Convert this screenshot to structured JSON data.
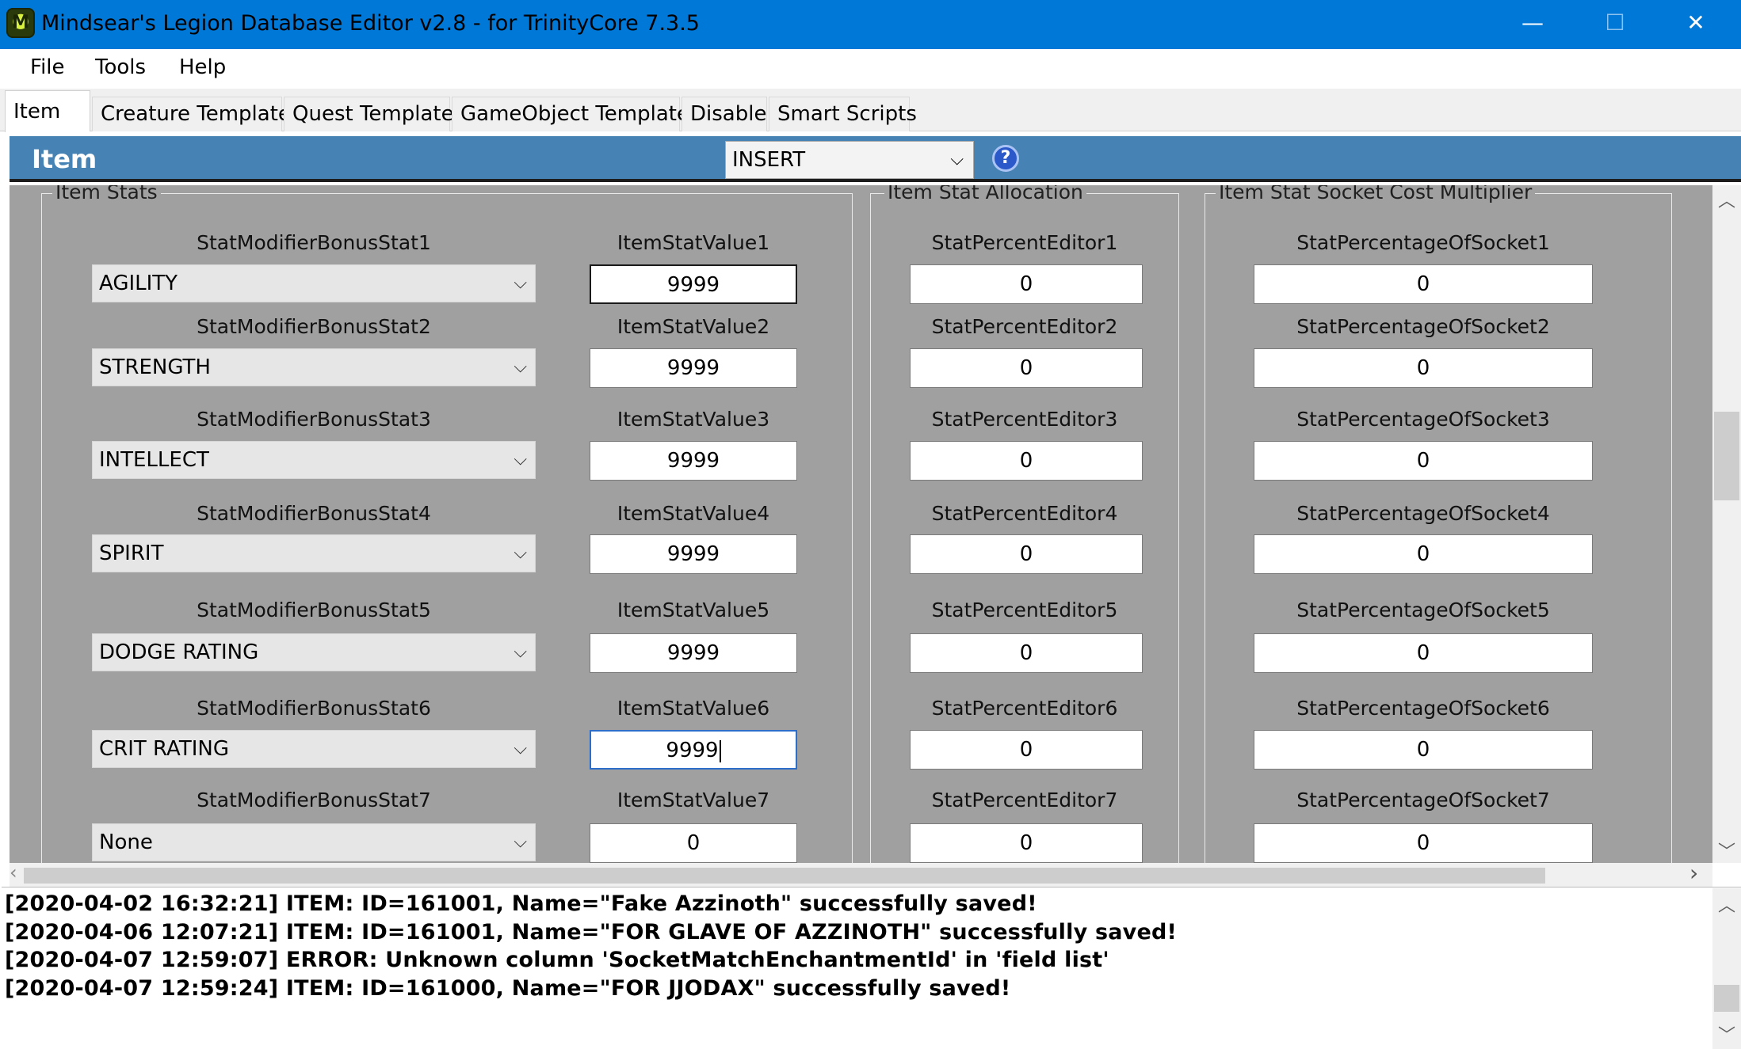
{
  "window": {
    "title": "Mindsear's Legion Database Editor v2.8 - for TrinityCore 7.3.5",
    "icon_letter": "M",
    "minimize_glyph": "—",
    "maximize_glyph": "☐",
    "close_glyph": "✕"
  },
  "menu": [
    "File",
    "Tools",
    "Help"
  ],
  "tabs": [
    {
      "label": "Item",
      "active": true
    },
    {
      "label": "Creature Template",
      "active": false
    },
    {
      "label": "Quest Template",
      "active": false
    },
    {
      "label": "GameObject Template",
      "active": false
    },
    {
      "label": "Disable",
      "active": false
    },
    {
      "label": "Smart Scripts",
      "active": false
    }
  ],
  "header": {
    "title": "Item",
    "mode": "INSERT",
    "help_glyph": "?"
  },
  "groups": {
    "item_stats": "Item Stats",
    "stat_allocation": "Item Stat Allocation",
    "socket_multiplier": "Item Stat Socket Cost Multiplier"
  },
  "stats": [
    {
      "mod_label": "StatModifierBonusStat1",
      "mod_value": "AGILITY",
      "val_label": "ItemStatValue1",
      "val": "9999",
      "pct_label": "StatPercentEditor1",
      "pct": "0",
      "sock_label": "StatPercentageOfSocket1",
      "sock": "0"
    },
    {
      "mod_label": "StatModifierBonusStat2",
      "mod_value": "STRENGTH",
      "val_label": "ItemStatValue2",
      "val": "9999",
      "pct_label": "StatPercentEditor2",
      "pct": "0",
      "sock_label": "StatPercentageOfSocket2",
      "sock": "0"
    },
    {
      "mod_label": "StatModifierBonusStat3",
      "mod_value": "INTELLECT",
      "val_label": "ItemStatValue3",
      "val": "9999",
      "pct_label": "StatPercentEditor3",
      "pct": "0",
      "sock_label": "StatPercentageOfSocket3",
      "sock": "0"
    },
    {
      "mod_label": "StatModifierBonusStat4",
      "mod_value": "SPIRIT",
      "val_label": "ItemStatValue4",
      "val": "9999",
      "pct_label": "StatPercentEditor4",
      "pct": "0",
      "sock_label": "StatPercentageOfSocket4",
      "sock": "0"
    },
    {
      "mod_label": "StatModifierBonusStat5",
      "mod_value": "DODGE RATING",
      "val_label": "ItemStatValue5",
      "val": "9999",
      "pct_label": "StatPercentEditor5",
      "pct": "0",
      "sock_label": "StatPercentageOfSocket5",
      "sock": "0"
    },
    {
      "mod_label": "StatModifierBonusStat6",
      "mod_value": "CRIT RATING",
      "val_label": "ItemStatValue6",
      "val": "9999",
      "pct_label": "StatPercentEditor6",
      "pct": "0",
      "sock_label": "StatPercentageOfSocket6",
      "sock": "0"
    },
    {
      "mod_label": "StatModifierBonusStat7",
      "mod_value": "None",
      "val_label": "ItemStatValue7",
      "val": "0",
      "pct_label": "StatPercentEditor7",
      "pct": "0",
      "sock_label": "StatPercentageOfSocket7",
      "sock": "0"
    }
  ],
  "log": [
    "[2020-04-02 16:32:21] ITEM: ID=161001, Name=\"Fake Azzinoth\" successfully saved!",
    "[2020-04-06 12:07:21] ITEM: ID=161001, Name=\"FOR GLAVE OF AZZINOTH\" successfully saved!",
    "[2020-04-07 12:59:07] ERROR: Unknown column 'SocketMatchEnchantmentId' in 'field list'",
    "[2020-04-07 12:59:24] ITEM: ID=161000, Name=\"FOR JJODAX\" successfully saved!"
  ],
  "glyphs": {
    "chevron_down": "⌵",
    "arrow_up": "︿",
    "arrow_down": "﹀",
    "arrow_left": "‹",
    "arrow_right": "›"
  }
}
